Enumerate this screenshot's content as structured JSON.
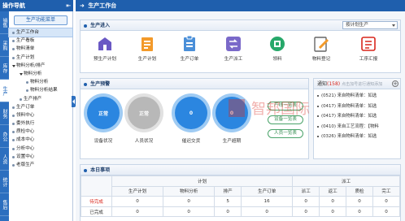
{
  "nav": {
    "title": "操作导航",
    "pin": "⇤",
    "menu_button": "生产功能菜单",
    "vtabs": [
      "销售",
      "采购",
      "库存",
      "生产",
      "财务",
      "办公",
      "人资",
      "统计",
      "售后"
    ],
    "tree": [
      {
        "label": "生产工作台",
        "level": 1
      },
      {
        "label": "生产看板",
        "level": 1
      },
      {
        "label": "物料清单",
        "level": 1
      },
      {
        "label": "生产计划",
        "level": 1
      },
      {
        "label": "物料分析/排产",
        "level": 1,
        "open": true
      },
      {
        "label": "物料分析",
        "level": 2,
        "open": true
      },
      {
        "label": "物料分析",
        "level": 3
      },
      {
        "label": "物料分析结果",
        "level": 3
      },
      {
        "label": "生产排产",
        "level": 2
      },
      {
        "label": "生产订单",
        "level": 1
      },
      {
        "label": "领料中心",
        "level": 1
      },
      {
        "label": "委外执行",
        "level": 1
      },
      {
        "label": "质检中心",
        "level": 1
      },
      {
        "label": "成本中心",
        "level": 1
      },
      {
        "label": "分析中心",
        "level": 1
      },
      {
        "label": "设置中心",
        "level": 1
      },
      {
        "label": "老版生产",
        "level": 1
      }
    ]
  },
  "main": {
    "header": "生产工作台",
    "quick": {
      "title": "生产进入",
      "select_value": "按计划生产",
      "items": [
        {
          "label": "预生产计划",
          "icon": "pre-plan-icon",
          "color": "#6a58c4"
        },
        {
          "label": "生产计划",
          "icon": "plan-icon",
          "color": "#f39a2a"
        },
        {
          "label": "生产订单",
          "icon": "order-icon",
          "color": "#4a8fd8"
        },
        {
          "label": "生产派工",
          "icon": "dispatch-icon",
          "color": "#7a69c9"
        },
        {
          "label": "领料",
          "icon": "material-icon",
          "color": "#27a86a"
        },
        {
          "label": "物料登记",
          "icon": "register-icon",
          "color": "#f39a2a"
        },
        {
          "label": "工序汇报",
          "icon": "report-icon",
          "color": "#d9261c"
        }
      ]
    },
    "prod": {
      "title": "生产预警",
      "circles": [
        {
          "value": "正常",
          "label": "设备状况",
          "color": "#2b86e0",
          "ring": "#9fcbf3"
        },
        {
          "value": "正常",
          "label": "人员状况",
          "color": "#b8b8b8",
          "ring": "#e1e1e1"
        },
        {
          "value": "0",
          "label": "催迟交货",
          "color": "#2b86e0",
          "ring": "#9fcbf3"
        },
        {
          "value": "0",
          "label": "生产超期",
          "color": "#2b86e0",
          "ring": "#9fcbf3"
        }
      ],
      "buttons": [
        "产线一览表",
        "设备一览表",
        "人员一览表"
      ]
    },
    "notice": {
      "title": "通知",
      "count": "(158)",
      "hint": "点击加号进行通知添加",
      "items": [
        "(0521) 来自物料清单：如选",
        "(0417) 来自物料清单：如选",
        "(0417) 来自物料清单：如选",
        "(0410) 来自工艺流程：【物料",
        "(0326) 来自物料清单：如选"
      ]
    },
    "today": {
      "title": "本日事项",
      "group_plan": "计划",
      "group_dispatch": "派工",
      "cols": [
        "生产计划",
        "物料分析",
        "排产",
        "生产订单",
        "派工",
        "返工",
        "质检",
        "完工"
      ],
      "rows": [
        {
          "label": "待完成",
          "values": [
            "0",
            "0",
            "5",
            "16",
            "0",
            "0",
            "0",
            "0"
          ]
        },
        {
          "label": "已完成",
          "values": [
            "0",
            "0",
            "0",
            "0",
            "0",
            "0",
            "0",
            "0"
          ]
        }
      ]
    },
    "watermark": "智邦国际"
  }
}
